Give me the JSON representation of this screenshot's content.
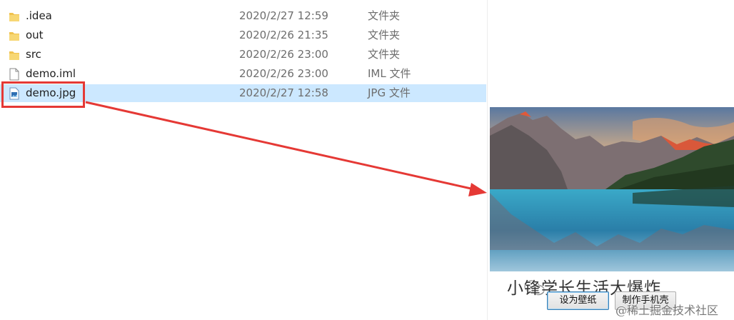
{
  "files": [
    {
      "name": ".idea",
      "date": "2020/2/27 12:59",
      "type": "文件夹",
      "icon": "folder-icon"
    },
    {
      "name": "out",
      "date": "2020/2/26 21:35",
      "type": "文件夹",
      "icon": "folder-icon"
    },
    {
      "name": "src",
      "date": "2020/2/26 23:00",
      "type": "文件夹",
      "icon": "folder-icon"
    },
    {
      "name": "demo.iml",
      "date": "2020/2/26 23:00",
      "type": "IML 文件",
      "icon": "file-icon"
    },
    {
      "name": "demo.jpg",
      "date": "2020/2/27 12:58",
      "type": "JPG 文件",
      "icon": "image-file-icon"
    }
  ],
  "selected_file": "demo.jpg",
  "preview": {
    "buttons": {
      "wallpaper": "设为壁纸",
      "phone_case": "制作手机壳"
    }
  },
  "watermark": {
    "text": "小锋学长生活大爆炸",
    "credit": "@稀土掘金技术社区"
  },
  "colors": {
    "selection": "#cce8ff",
    "annotation": "#e53935",
    "folder": "#f0c24f"
  }
}
